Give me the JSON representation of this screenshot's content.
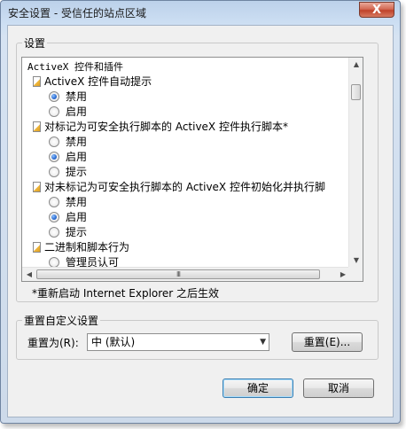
{
  "window": {
    "title": "安全设置 - 受信任的站点区域",
    "close_glyph": "X"
  },
  "settings_group": {
    "label": "设置",
    "items": [
      {
        "type": "header",
        "text": "ActiveX 控件和插件"
      },
      {
        "type": "option",
        "text": "ActiveX 控件自动提示"
      },
      {
        "type": "radio",
        "text": "禁用",
        "checked": true
      },
      {
        "type": "radio",
        "text": "启用",
        "checked": false
      },
      {
        "type": "option",
        "text": "对标记为可安全执行脚本的 ActiveX 控件执行脚本*"
      },
      {
        "type": "radio",
        "text": "禁用",
        "checked": false
      },
      {
        "type": "radio",
        "text": "启用",
        "checked": true
      },
      {
        "type": "radio",
        "text": "提示",
        "checked": false
      },
      {
        "type": "option",
        "text": "对未标记为可安全执行脚本的 ActiveX 控件初始化并执行脚"
      },
      {
        "type": "radio",
        "text": "禁用",
        "checked": false
      },
      {
        "type": "radio",
        "text": "启用",
        "checked": true
      },
      {
        "type": "radio",
        "text": "提示",
        "checked": false
      },
      {
        "type": "option",
        "text": "二进制和脚本行为"
      },
      {
        "type": "radio",
        "text": "管理员认可",
        "checked": false
      }
    ],
    "hscroll_grip": "III"
  },
  "note": "*重新启动 Internet Explorer 之后生效",
  "reset_group": {
    "label": "重置自定义设置",
    "reset_to_label": "重置为(R):",
    "selected_level": "中 (默认)",
    "reset_button": "重置(E)..."
  },
  "buttons": {
    "ok": "确定",
    "cancel": "取消"
  }
}
